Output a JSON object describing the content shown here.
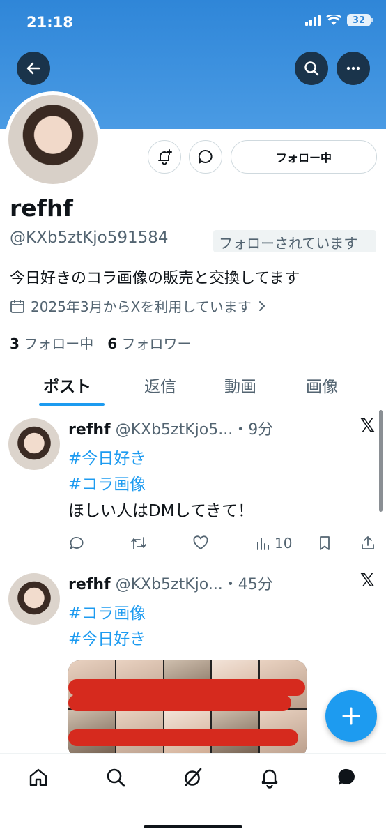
{
  "status_bar": {
    "time": "21:18",
    "battery": "32"
  },
  "profile": {
    "name": "refhf",
    "handle": "@KXb5ztKjo591584",
    "follows_you": "フォローされています",
    "follow_button": "フォロー中",
    "bio": "今日好きのコラ画像の販売と交換してます",
    "joined": "2025年3月からXを利用しています",
    "following_count": "3",
    "following_label": "フォロー中",
    "followers_count": "6",
    "followers_label": "フォロワー"
  },
  "tabs": [
    {
      "label": "ポスト",
      "active": true
    },
    {
      "label": "返信",
      "active": false
    },
    {
      "label": "動画",
      "active": false
    },
    {
      "label": "画像",
      "active": false
    }
  ],
  "posts": [
    {
      "name": "refhf",
      "handle_time": "@KXb5ztKjo5...・9分",
      "hashtags": [
        "#今日好き",
        "#コラ画像"
      ],
      "text": "ほしい人はDMしてきて！",
      "views": "10"
    },
    {
      "name": "refhf",
      "handle_time": "@KXb5ztKjo...・45分",
      "hashtags": [
        "#コラ画像",
        "#今日好き"
      ]
    }
  ],
  "icons": {
    "back": "back-arrow-icon",
    "search": "search-icon",
    "more": "more-icon",
    "notify": "bell-plus-icon",
    "message": "chat-bubble-icon",
    "calendar": "calendar-icon",
    "x_logo": "x-logo-icon",
    "reply": "reply-icon",
    "repost": "repost-icon",
    "like": "heart-icon",
    "views": "views-icon",
    "bookmark": "bookmark-icon",
    "share": "share-icon",
    "compose": "plus-icon",
    "nav": [
      "home-icon",
      "search-icon",
      "grok-icon",
      "bell-icon",
      "messages-icon"
    ]
  },
  "colors": {
    "accent": "#1d9bf0",
    "banner": "#2f86d8",
    "text": "#0f1419",
    "muted": "#536471",
    "redaction": "#d62a1e"
  }
}
